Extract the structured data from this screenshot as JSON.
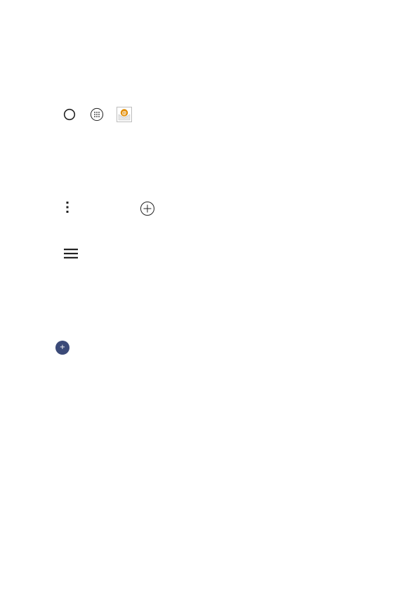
{
  "icons": {
    "row1": [
      "home-icon",
      "apps-icon",
      "email-icon"
    ],
    "row2": [
      "menu-dots-icon",
      "add-circle-icon"
    ],
    "row3": [
      "hamburger-icon"
    ],
    "row4": [
      "fab-add-icon"
    ]
  },
  "fab": {
    "symbol": "+"
  },
  "colors": {
    "icon_stroke": "#222222",
    "fab_background": "#3b4a78",
    "fab_foreground": "#ffffff",
    "email_accent": "#e08a00",
    "email_envelope": "#e6e6e6"
  }
}
